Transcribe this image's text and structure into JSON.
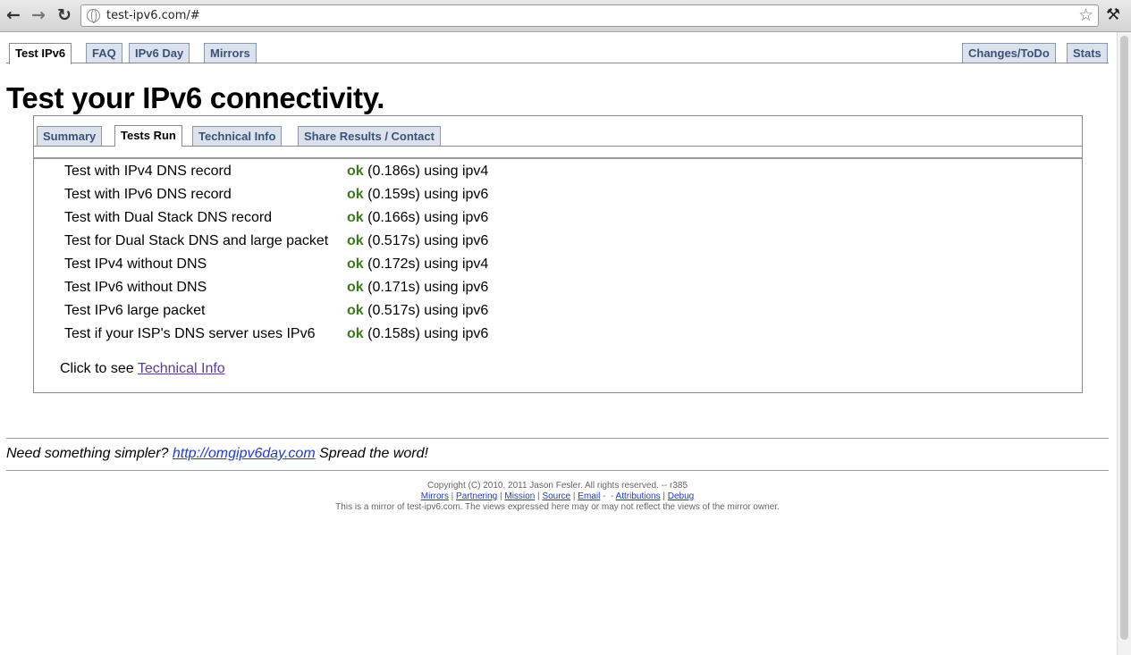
{
  "browser": {
    "url": "test-ipv6.com/#",
    "back_icon": "←",
    "forward_icon": "→",
    "reload_icon": "↻",
    "star_icon": "☆",
    "wrench_icon": "🔧"
  },
  "top_tabs": [
    {
      "label": "Test IPv6",
      "active": true
    },
    {
      "label": "FAQ",
      "active": false
    },
    {
      "label": "IPv6 Day",
      "active": false
    },
    {
      "label": "Mirrors",
      "active": false
    }
  ],
  "top_tabs_right": [
    {
      "label": "Changes/ToDo"
    },
    {
      "label": "Stats"
    }
  ],
  "page_title": "Test your IPv6 connectivity.",
  "inner_tabs": [
    {
      "label": "Summary",
      "active": false
    },
    {
      "label": "Tests Run",
      "active": true
    },
    {
      "label": "Technical Info",
      "active": false
    },
    {
      "label": "Share Results / Contact",
      "active": false
    }
  ],
  "tests": [
    {
      "name": "Test with IPv4 DNS record",
      "status": "ok",
      "detail": "(0.186s) using ipv4"
    },
    {
      "name": "Test with IPv6 DNS record",
      "status": "ok",
      "detail": "(0.159s) using ipv6"
    },
    {
      "name": "Test with Dual Stack DNS record",
      "status": "ok",
      "detail": "(0.166s) using ipv6"
    },
    {
      "name": "Test for Dual Stack DNS and large packet",
      "status": "ok",
      "detail": "(0.517s) using ipv6"
    },
    {
      "name": "Test IPv4 without DNS",
      "status": "ok",
      "detail": "(0.172s) using ipv4"
    },
    {
      "name": "Test IPv6 without DNS",
      "status": "ok",
      "detail": "(0.171s) using ipv6"
    },
    {
      "name": "Test IPv6 large packet",
      "status": "ok",
      "detail": "(0.517s) using ipv6"
    },
    {
      "name": "Test if your ISP's DNS server uses IPv6",
      "status": "ok",
      "detail": "(0.158s) using ipv6"
    }
  ],
  "click_to_see": {
    "prefix": "Click to see",
    "link": "Technical Info"
  },
  "simpler": {
    "prefix": "Need something simpler?",
    "link": "http://omgipv6day.com",
    "suffix": "Spread the word!"
  },
  "footer": {
    "copyright": "Copyright (C) 2010, 2011 Jason Fesler. All rights reserved. -- r385",
    "links": [
      "Mirrors",
      "Partnering",
      "Mission",
      "Source",
      "Email",
      "Attributions",
      "Debug"
    ],
    "mirror_note": "This is a mirror of test-ipv6.com. The views expressed here may or may not reflect the views of the mirror owner."
  },
  "colors": {
    "ok": "#3b7a1a",
    "tab_bg": "#dbe2ec",
    "tab_text": "#39527a",
    "link": "#5a3d99"
  }
}
